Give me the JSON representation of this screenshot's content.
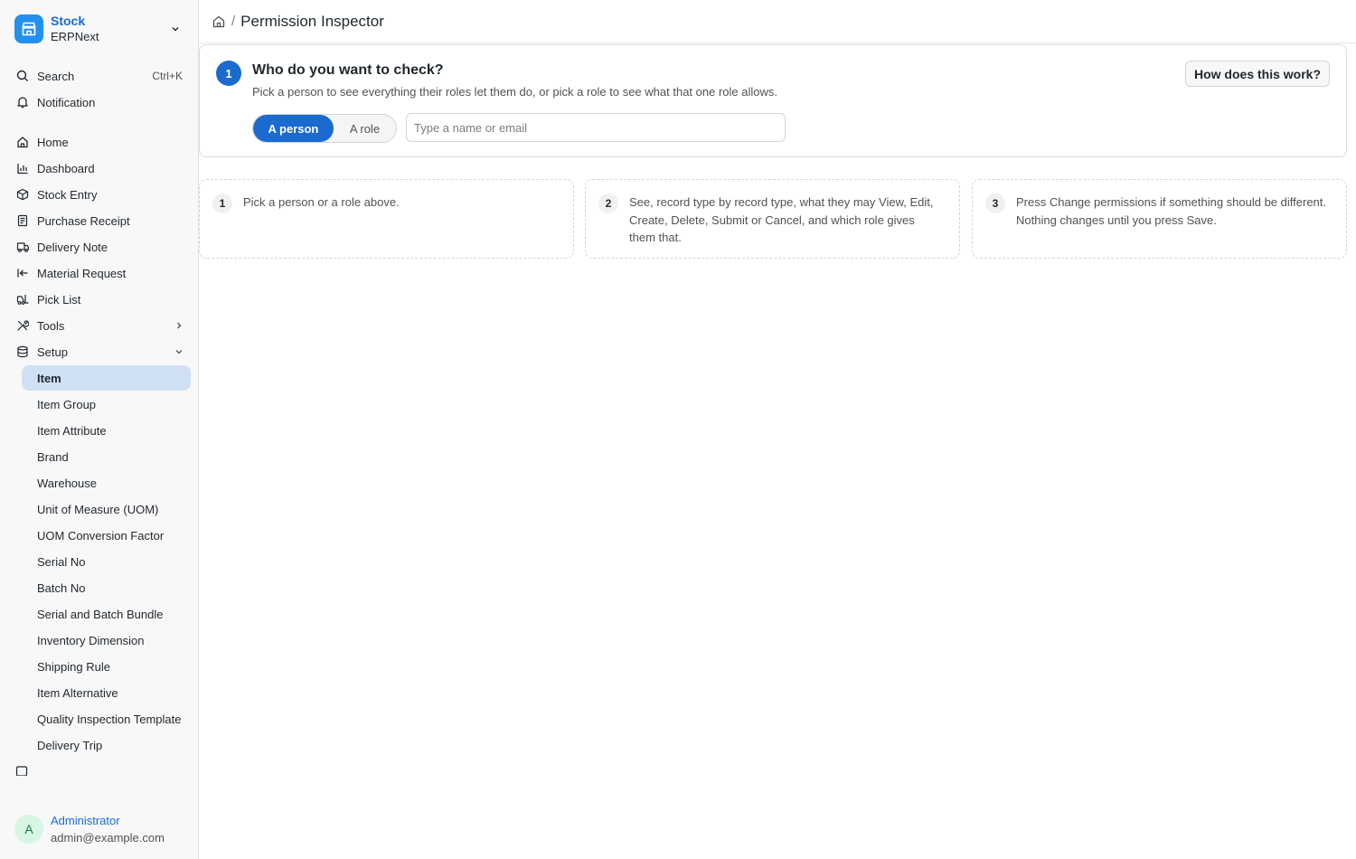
{
  "app": {
    "name": "Stock",
    "subtitle": "ERPNext"
  },
  "sidebar": {
    "search": {
      "label": "Search",
      "shortcut": "Ctrl+K"
    },
    "notification": {
      "label": "Notification"
    },
    "items": [
      {
        "label": "Home",
        "icon": "home-icon"
      },
      {
        "label": "Dashboard",
        "icon": "bar-chart-icon"
      },
      {
        "label": "Stock Entry",
        "icon": "box-icon"
      },
      {
        "label": "Purchase Receipt",
        "icon": "receipt-icon"
      },
      {
        "label": "Delivery Note",
        "icon": "truck-icon"
      },
      {
        "label": "Material Request",
        "icon": "arrow-left-to-line-icon"
      },
      {
        "label": "Pick List",
        "icon": "forklift-icon"
      },
      {
        "label": "Tools",
        "icon": "tools-icon"
      },
      {
        "label": "Setup",
        "icon": "database-icon"
      }
    ],
    "setup_items": [
      "Item",
      "Item Group",
      "Item Attribute",
      "Brand",
      "Warehouse",
      "Unit of Measure (UOM)",
      "UOM Conversion Factor",
      "Serial No",
      "Batch No",
      "Serial and Batch Bundle",
      "Inventory Dimension",
      "Shipping Rule",
      "Item Alternative",
      "Quality Inspection Template",
      "Delivery Trip"
    ],
    "active_setup_item": "Item"
  },
  "user": {
    "initial": "A",
    "name": "Administrator",
    "email": "admin@example.com"
  },
  "header": {
    "separator": "/",
    "title": "Permission Inspector"
  },
  "step_card": {
    "step": "1",
    "title": "Who do you want to check?",
    "subtitle": "Pick a person to see everything their roles let them do, or pick a role to see what that one role allows.",
    "help_label": "How does this work?",
    "mode_person": "A person",
    "mode_role": "A role",
    "selected_mode": "A person",
    "search_placeholder": "Type a name or email",
    "search_value": ""
  },
  "hints": [
    {
      "num": "1",
      "text": "Pick a person or a role above."
    },
    {
      "num": "2",
      "text": "See, record type by record type, what they may View, Edit, Create, Delete, Submit or Cancel, and which role gives them that."
    },
    {
      "num": "3",
      "text": "Press Change permissions if something should be different. Nothing changes until you press Save."
    }
  ],
  "colors": {
    "accent": "#1a6ad0",
    "logo": "#2490ef",
    "active_bg": "#d0e0f5"
  }
}
